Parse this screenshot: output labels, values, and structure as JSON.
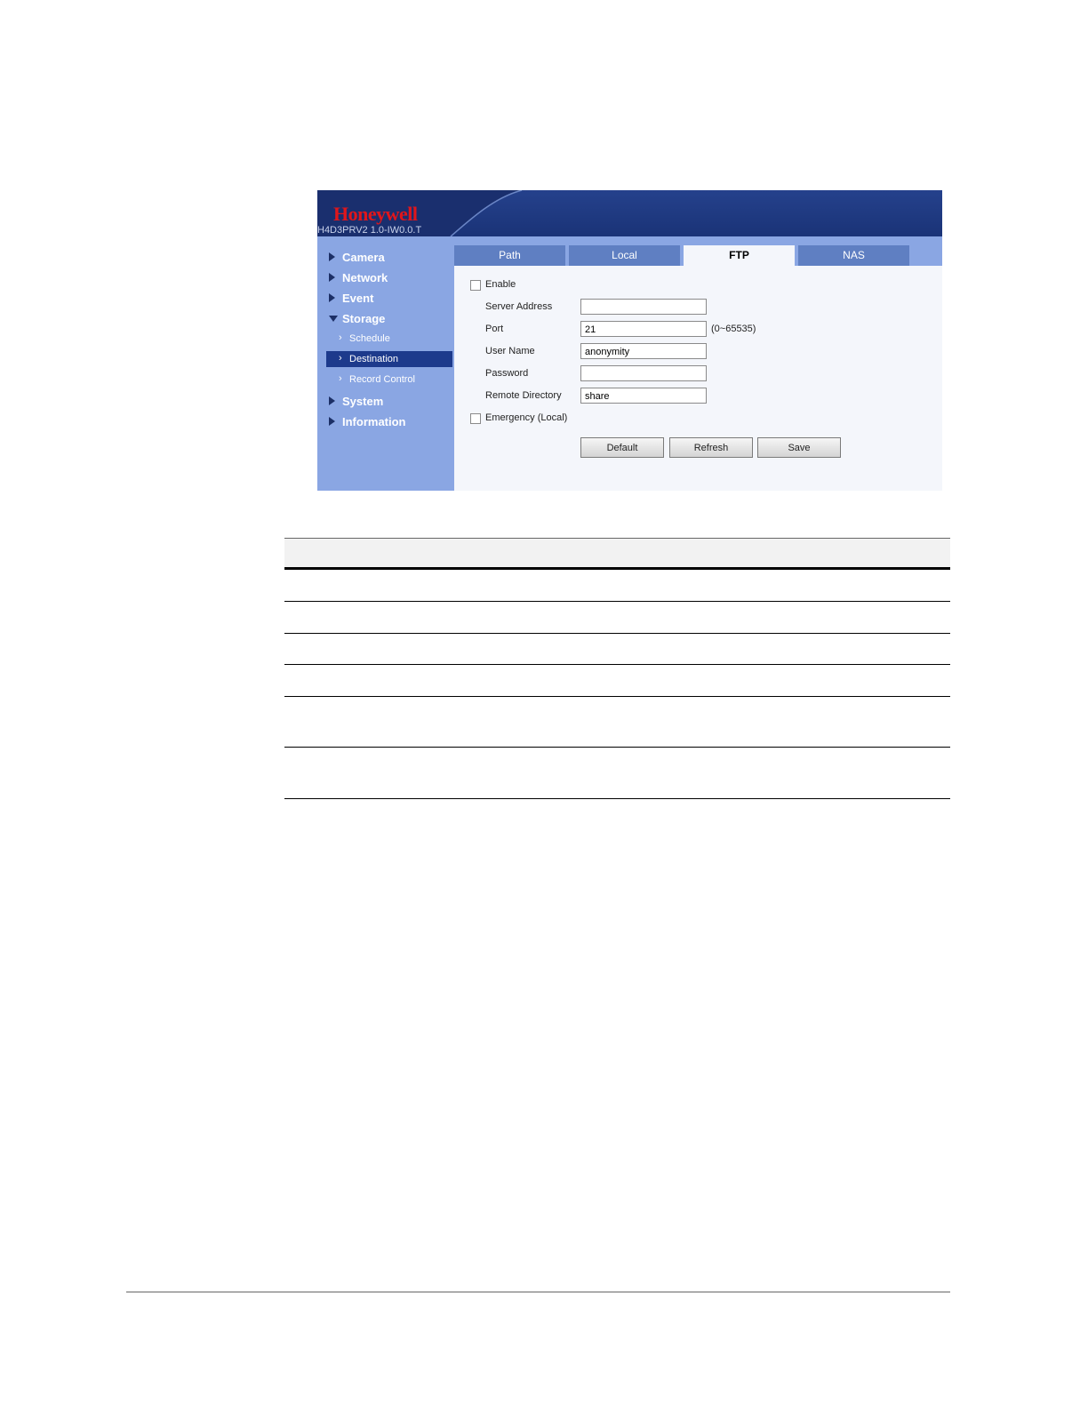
{
  "app": {
    "brand": "Honeywell",
    "version": "H4D3PRV2  1.0-IW0.0.T",
    "nav": {
      "camera": "Camera",
      "network": "Network",
      "event": "Event",
      "storage": "Storage",
      "schedule": "Schedule",
      "destination": "Destination",
      "record_control": "Record Control",
      "system": "System",
      "information": "Information"
    },
    "tabs": {
      "path": "Path",
      "local": "Local",
      "ftp": "FTP",
      "nas": "NAS"
    },
    "form": {
      "enable_label": "Enable",
      "server_address_label": "Server Address",
      "server_address_value": "",
      "port_label": "Port",
      "port_value": "21",
      "port_range": "(0~65535)",
      "user_name_label": "User Name",
      "user_name_value": "anonymity",
      "password_label": "Password",
      "password_value": "",
      "remote_directory_label": "Remote Directory",
      "remote_directory_value": "share",
      "emergency_label": "Emergency (Local)"
    },
    "buttons": {
      "default": "Default",
      "refresh": "Refresh",
      "save": "Save"
    }
  }
}
